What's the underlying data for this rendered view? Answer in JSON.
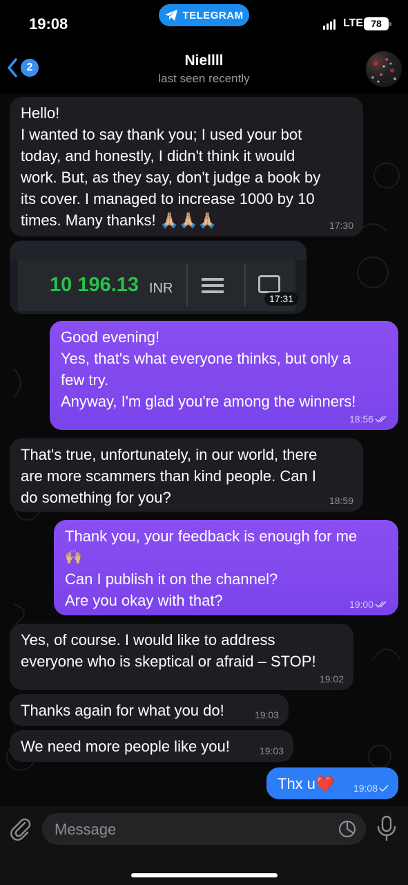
{
  "status": {
    "time": "19:08",
    "app_pill": "TELEGRAM",
    "network": "LTE",
    "battery": "78"
  },
  "header": {
    "back_count": "2",
    "title": "Niellll",
    "subtitle": "last seen recently"
  },
  "messages": [
    {
      "dir": "in",
      "lines": [
        "Hello!",
        "I wanted to say thank you; I used your bot",
        "today, and honestly, I didn't think it would",
        "work. But, as they say, don't judge a book by",
        "its cover. I managed to increase 1000 by 10",
        "times. Many thanks! 🙏🏼🙏🏼🙏🏼"
      ],
      "time": "17:30"
    },
    {
      "dir": "in",
      "type": "photo",
      "amount": "10 196.13",
      "currency": "INR",
      "time": "17:31"
    },
    {
      "dir": "out",
      "lines": [
        "Good evening!",
        "Yes, that's what everyone thinks, but only a",
        "few try.",
        "Anyway, I'm glad you're among the winners!"
      ],
      "time": "18:56"
    },
    {
      "dir": "in",
      "lines": [
        "That's true, unfortunately, in our world, there",
        "are more scammers than kind people. Can I",
        "do something for you?"
      ],
      "time": "18:59"
    },
    {
      "dir": "out",
      "lines": [
        "Thank you, your feedback is enough for me",
        "🙌🏼",
        "Can I publish it on the channel?",
        "Are you okay with that?"
      ],
      "time": "19:00"
    },
    {
      "dir": "in",
      "lines": [
        "Yes, of course. I would like to address",
        "everyone who is skeptical or afraid – STOP!"
      ],
      "time": "19:02"
    },
    {
      "dir": "in",
      "lines": [
        "Thanks again for what you do!"
      ],
      "time": "19:03"
    },
    {
      "dir": "in",
      "lines": [
        "We need more people like you!"
      ],
      "time": "19:03"
    },
    {
      "dir": "out",
      "lines": [
        "Thx u❤️"
      ],
      "time": "19:08"
    }
  ],
  "input": {
    "placeholder": "Message"
  },
  "icons": {
    "back": "chevron-left-icon",
    "attach": "paperclip-icon",
    "sticker": "sticker-icon",
    "mic": "microphone-icon",
    "read": "double-check-icon"
  },
  "colors": {
    "outgoing": "#7a44ea",
    "incoming": "#1f1d22",
    "last_outgoing": "#2d7df6",
    "accent": "#1a8cf0",
    "amount_green": "#26c24a"
  }
}
